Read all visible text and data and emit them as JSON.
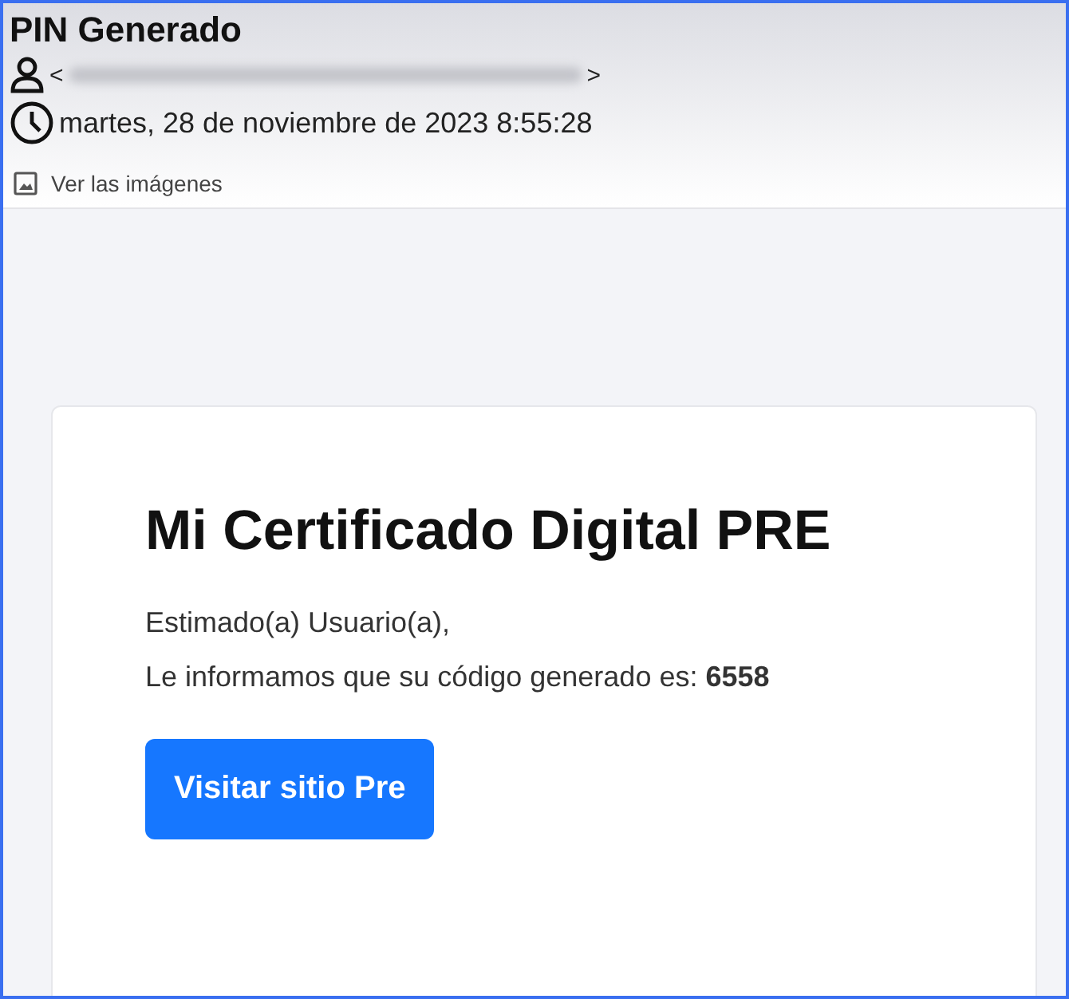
{
  "email": {
    "subject": "PIN Generado",
    "sender_open": "<",
    "sender_close": ">",
    "date": "martes, 28 de noviembre de 2023 8:55:28",
    "show_images_link": "Ver las imágenes"
  },
  "message": {
    "heading": "Mi Certificado Digital PRE",
    "greeting": "Estimado(a) Usuario(a),",
    "body": "Le informamos que su código generado es: **6558**",
    "button": "Visitar sitio Pre"
  }
}
